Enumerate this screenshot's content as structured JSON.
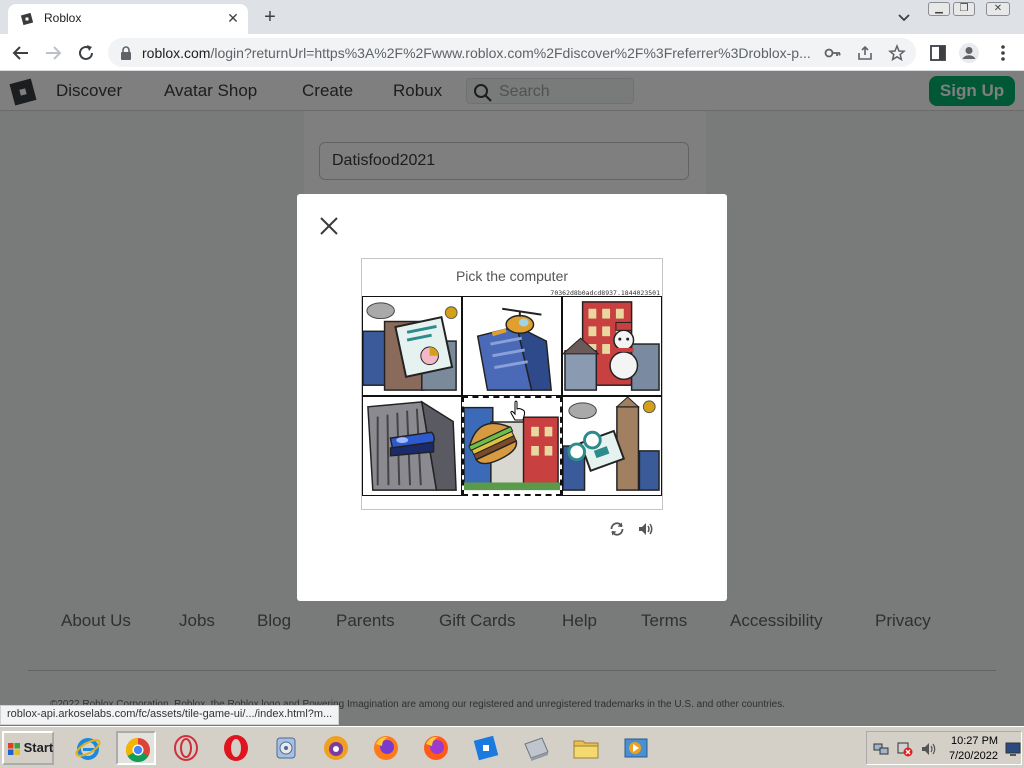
{
  "browser": {
    "tab_title": "Roblox",
    "tab_close_glyph": "✕",
    "new_tab_glyph": "+",
    "url_main": "roblox.com",
    "url_rest": "/login?returnUrl=https%3A%2F%2Fwww.roblox.com%2Fdiscover%2F%3Freferrer%3Droblox-p...",
    "window_controls": [
      "▁",
      "❐",
      "✕"
    ]
  },
  "site_nav": {
    "items": [
      "Discover",
      "Avatar Shop",
      "Create",
      "Robux"
    ],
    "search_placeholder": "Search",
    "signup_label": "Sign Up",
    "accent": "#00b06f"
  },
  "login": {
    "username_value": "Datisfood2021"
  },
  "captcha": {
    "prompt": "Pick the computer",
    "session_id": "70362d8b0adcd8937.1844023501",
    "tiles": [
      {
        "subject": "presentation-board-icon",
        "selected": false
      },
      {
        "subject": "helicopter-icon",
        "selected": false
      },
      {
        "subject": "snowman-icon",
        "selected": false
      },
      {
        "subject": "stapler-icon",
        "selected": false
      },
      {
        "subject": "burger-icon",
        "selected": true
      },
      {
        "subject": "film-camera-icon",
        "selected": false
      }
    ],
    "controls": [
      "refresh-icon",
      "audio-icon"
    ]
  },
  "footer": {
    "links": [
      "About Us",
      "Jobs",
      "Blog",
      "Parents",
      "Gift Cards",
      "Help",
      "Terms",
      "Accessibility",
      "Privacy"
    ],
    "copyright": "©2022 Roblox Corporation. Roblox, the Roblox logo and Powering Imagination are among our registered and unregistered trademarks in the U.S. and other countries."
  },
  "status_bar": {
    "url": "roblox-api.arkoselabs.com/fc/assets/tile-game-ui/.../index.html?m..."
  },
  "taskbar": {
    "start_label": "Start",
    "apps": [
      "internet-explorer-icon",
      "chrome-icon",
      "opera-gx-icon",
      "opera-icon",
      "media-player-icon",
      "tor-browser-icon",
      "firefox-icon",
      "firefox-icon",
      "roblox-icon",
      "disk-icon",
      "folder-icon",
      "video-icon"
    ],
    "time": "10:27 PM",
    "date": "7/20/2022"
  }
}
